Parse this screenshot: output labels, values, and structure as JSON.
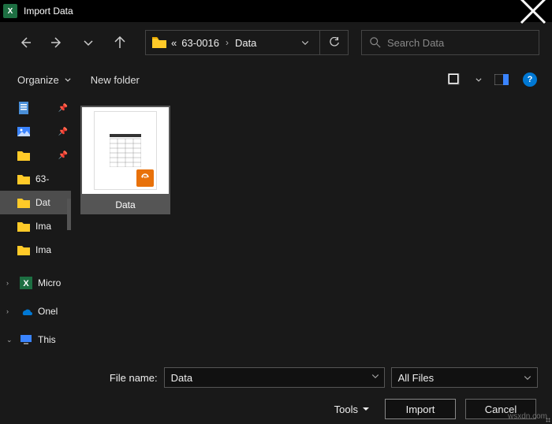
{
  "window": {
    "title": "Import Data"
  },
  "breadcrumb": {
    "parts": [
      "«",
      "63-0016",
      "Data"
    ],
    "sep": "›"
  },
  "search": {
    "placeholder": "Search Data"
  },
  "toolbar": {
    "organize": "Organize",
    "newfolder": "New folder"
  },
  "sidebar": {
    "items": [
      {
        "name": "doc",
        "label": "",
        "pinned": true
      },
      {
        "name": "pics",
        "label": "",
        "pinned": true
      },
      {
        "name": "fldr",
        "label": "",
        "pinned": true
      },
      {
        "name": "63",
        "label": "63-"
      },
      {
        "name": "data",
        "label": "Dat"
      },
      {
        "name": "ima1",
        "label": "Ima"
      },
      {
        "name": "ima2",
        "label": "Ima"
      },
      {
        "name": "micro",
        "label": "Micro"
      },
      {
        "name": "one",
        "label": "Onel"
      },
      {
        "name": "this",
        "label": "This"
      }
    ]
  },
  "files": [
    {
      "name": "Data"
    }
  ],
  "bottom": {
    "filename_label": "File name:",
    "filename_value": "Data",
    "filter": "All Files",
    "tools": "Tools",
    "import": "Import",
    "cancel": "Cancel"
  },
  "watermark": "wsxdn.com"
}
